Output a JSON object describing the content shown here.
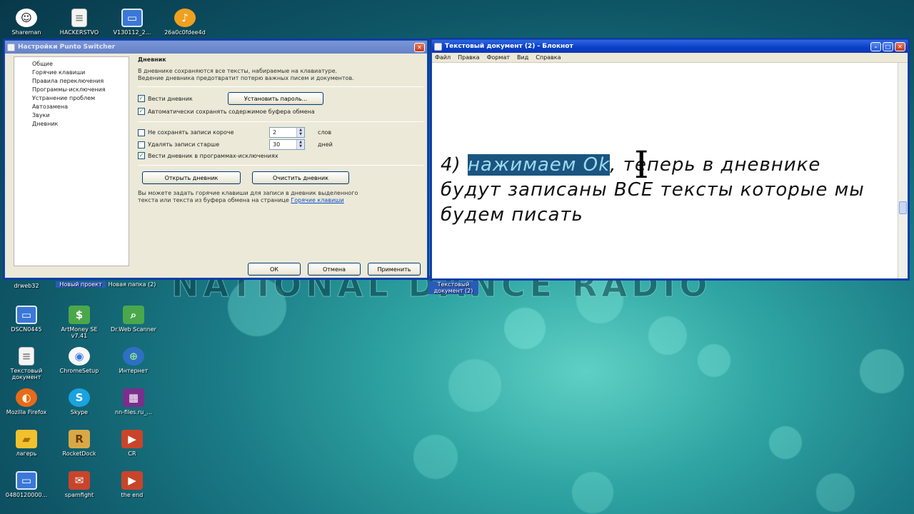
{
  "desktop": {
    "watermark": "NATIONAL DANCE RADIO",
    "top_icons": [
      {
        "label": "Shareman",
        "icon": "face-icon"
      },
      {
        "label": "HACKERSTVO",
        "icon": "document-icon"
      },
      {
        "label": "V130112_2...",
        "icon": "monitor-icon"
      },
      {
        "label": "26a0c0fdee4d",
        "icon": "mp3-icon"
      }
    ],
    "icons": [
      {
        "label": "drweb32"
      },
      {
        "label": "Новый проект"
      },
      {
        "label": "Новая папка (2)"
      },
      {
        "label": "DSCN0445",
        "icon": "monitor-icon"
      },
      {
        "label": "ArtMoney SE v7.41",
        "icon": "money-icon"
      },
      {
        "label": "Dr.Web Scanner",
        "icon": "scanner-icon"
      },
      {
        "label": "Текстовый документ",
        "icon": "document-icon"
      },
      {
        "label": "ChromeSetup",
        "icon": "chrome-icon"
      },
      {
        "label": "Интернет",
        "icon": "network-icon"
      },
      {
        "label": "Mozilla Firefox",
        "icon": "firefox-icon"
      },
      {
        "label": "Skype",
        "icon": "skype-icon"
      },
      {
        "label": "nn-files.ru_...",
        "icon": "rar-icon"
      },
      {
        "label": "лагерь",
        "icon": "folder-icon"
      },
      {
        "label": "RocketDock",
        "icon": "rocketdock-icon"
      },
      {
        "label": "CR",
        "icon": "media-icon"
      },
      {
        "label": "0480120000...",
        "icon": "monitor-icon"
      },
      {
        "label": "spamfight",
        "icon": "spamfight-icon"
      },
      {
        "label": "the end",
        "icon": "media-icon"
      },
      {
        "label": "Текстовый документ (2)",
        "icon": "document-icon"
      }
    ]
  },
  "punto": {
    "title": "Настройки Punto Switcher",
    "tree": [
      "Общие",
      "Горячие клавиши",
      "Правила переключения",
      "Программы-исключения",
      "Устранение проблем",
      "Автозамена",
      "Звуки",
      "Дневник"
    ],
    "heading": "Дневник",
    "desc_line1": "В дневнике сохраняются все тексты, набираемые на клавиатуре.",
    "desc_line2": "Ведение дневника предотвратит потерю важных писем и документов.",
    "keep_diary": {
      "label": "Вести дневник",
      "checked": true
    },
    "set_password": "Установить пароль...",
    "save_clipboard": {
      "label": "Автоматически сохранять содержимое буфера обмена",
      "checked": true
    },
    "skip_short": {
      "label": "Не сохранять записи короче",
      "value": "2",
      "unit": "слов",
      "checked": false
    },
    "delete_old": {
      "label": "Удалять записи старше",
      "value": "30",
      "unit": "дней",
      "checked": false
    },
    "in_exceptions": {
      "label": "Вести дневник в программах-исключениях",
      "checked": true
    },
    "open_diary": "Открыть дневник",
    "clear_diary": "Очистить дневник",
    "hint_line1": "Вы можете задать горячие клавиши для записи в дневник выделенного",
    "hint_line2": "текста или текста из буфера обмена на странице",
    "hint_link": "Горячие клавиши",
    "ok": "ОК",
    "cancel": "Отмена",
    "apply": "Применить"
  },
  "notepad": {
    "title": "Текстовый документ (2) - Блокнот",
    "menu": [
      "Файл",
      "Правка",
      "Формат",
      "Вид",
      "Справка"
    ],
    "text_prefix": "4) ",
    "text_selected": "нажимаем Ok",
    "text_rest": ", теперь в дневнике будут записаны ВСЕ тексты которые мы будем писать"
  }
}
